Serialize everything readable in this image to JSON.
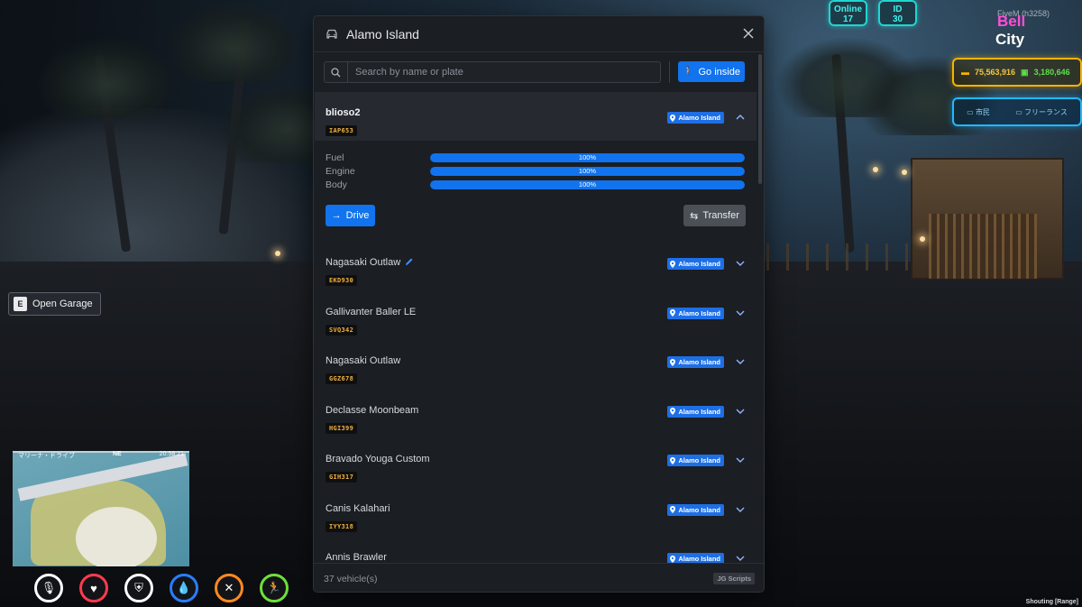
{
  "hud": {
    "online_label": "Online",
    "online_count": "17",
    "id_label": "ID",
    "id_value": "30",
    "server_sub": "FiveM (h3258)",
    "brand_line1": "Bell",
    "brand_line2": "City",
    "cash": "75,563,916",
    "bank": "3,180,646",
    "job1": "市民",
    "job2": "フリーランス",
    "accent_teal": "#1fd6cf",
    "accent_gold": "#f5b400",
    "accent_blue": "#22b8ff"
  },
  "prompt": {
    "key": "E",
    "label": "Open Garage"
  },
  "minimap": {
    "street": "マリーナ・ドライブ",
    "heading": "NE",
    "time": "20:58:21"
  },
  "status_icons": [
    {
      "name": "microphone-icon",
      "glyph": "🎙",
      "color": "#ffffff"
    },
    {
      "name": "heart-icon",
      "glyph": "♥",
      "color": "#ff3b4d"
    },
    {
      "name": "shield-icon",
      "glyph": "⛨",
      "color": "#ffffff"
    },
    {
      "name": "water-drop-icon",
      "glyph": "💧",
      "color": "#2a7dff"
    },
    {
      "name": "food-icon",
      "glyph": "✕",
      "color": "#ff8a1f"
    },
    {
      "name": "stamina-icon",
      "glyph": "🏃",
      "color": "#6fe03a"
    }
  ],
  "corner_status": "Shouting [Range]",
  "garage": {
    "title": "Alamo Island",
    "search_placeholder": "Search by name or plate",
    "go_inside_label": "Go inside",
    "accent": "#1173ee",
    "vehicles": [
      {
        "name": "blioso2",
        "plate": "IAP653",
        "location": "Alamo Island",
        "expanded": true
      },
      {
        "name": "Nagasaki Outlaw",
        "plate": "EKD930",
        "location": "Alamo Island",
        "editable": true
      },
      {
        "name": "Gallivanter Baller LE",
        "plate": "SVQ342",
        "location": "Alamo Island"
      },
      {
        "name": "Nagasaki Outlaw",
        "plate": "GGZ678",
        "location": "Alamo Island"
      },
      {
        "name": "Declasse Moonbeam",
        "plate": "HGI399",
        "location": "Alamo Island"
      },
      {
        "name": "Bravado Youga Custom",
        "plate": "GIH317",
        "location": "Alamo Island"
      },
      {
        "name": "Canis Kalahari",
        "plate": "IYY318",
        "location": "Alamo Island"
      },
      {
        "name": "Annis Brawler",
        "plate": "",
        "location": "Alamo Island"
      }
    ],
    "stats": [
      {
        "label": "Fuel",
        "value": "100%",
        "fraction": 1.0
      },
      {
        "label": "Engine",
        "value": "100%",
        "fraction": 1.0
      },
      {
        "label": "Body",
        "value": "100%",
        "fraction": 1.0
      }
    ],
    "drive_label": "Drive",
    "transfer_label": "Transfer",
    "footer_count": "37 vehicle(s)",
    "footer_brand": "JG Scripts"
  }
}
